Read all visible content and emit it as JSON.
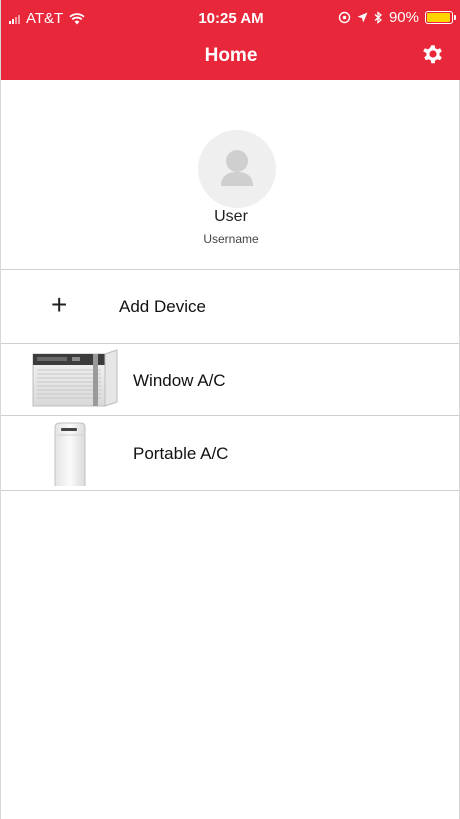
{
  "status_bar": {
    "carrier": "AT&T",
    "time": "10:25 AM",
    "battery": "90%",
    "battery_level": 0.9
  },
  "header": {
    "title": "Home",
    "settings_icon": "gear-icon",
    "color": "#e8273a"
  },
  "profile": {
    "avatar_icon": "person-icon",
    "name": "User",
    "username": "Username"
  },
  "add_device": {
    "icon": "plus-icon",
    "label": "Add Device"
  },
  "devices": [
    {
      "label": "Window A/C",
      "image": "window-ac-image"
    },
    {
      "label": "Portable A/C",
      "image": "portable-ac-image"
    }
  ]
}
